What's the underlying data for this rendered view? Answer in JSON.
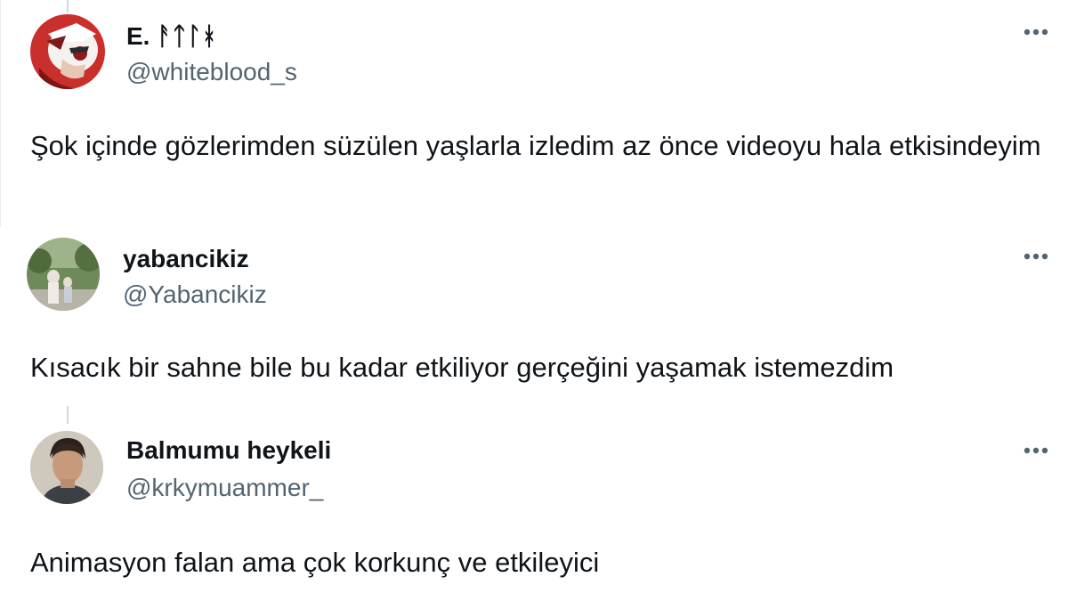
{
  "tweets": [
    {
      "display_name": "E. ᚨᛏᛚᚼ",
      "handle": "@whiteblood_s",
      "text": "Şok içinde gözlerimden süzülen yaşlarla izledim az önce videoyu hala etkisindeyim",
      "avatar_icon": "anime-character-avatar-icon",
      "more_icon": "more-options-icon"
    },
    {
      "display_name": "yabancikiz",
      "handle": "@Yabancikiz",
      "text": "Kısacık bir sahne bile bu kadar etkiliyor gerçeğini yaşamak istemezdim",
      "avatar_icon": "photo-avatar-icon",
      "more_icon": "more-options-icon"
    },
    {
      "display_name": "Balmumu heykeli",
      "handle": "@krkymuammer_",
      "text": "Animasyon falan ama çok korkunç ve etkileyici",
      "avatar_icon": "person-avatar-icon",
      "more_icon": "more-options-icon"
    }
  ],
  "colors": {
    "text_primary": "#0f1419",
    "text_secondary": "#536471",
    "thread_line": "#cfd9de"
  }
}
